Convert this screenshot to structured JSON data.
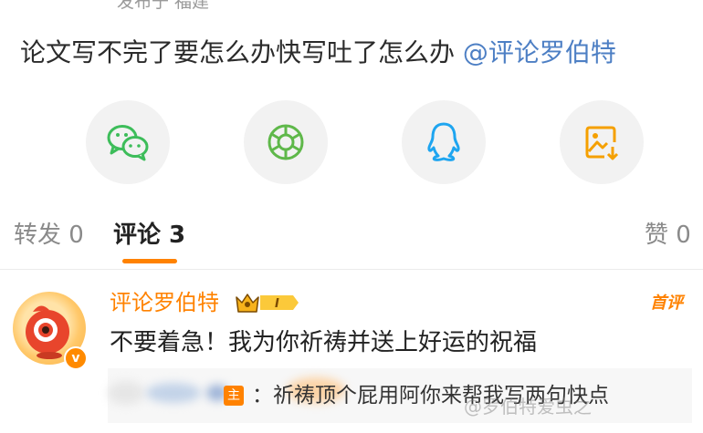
{
  "post": {
    "meta": "发布于 福建",
    "text": "论文写不完了要怎么办快写吐了怎么办 ",
    "mention": "@评论罗伯特"
  },
  "share": {
    "items": [
      {
        "icon": "wechat-icon",
        "color": "#3dbd5a"
      },
      {
        "icon": "moments-icon",
        "color": "#5fb84a"
      },
      {
        "icon": "qq-icon",
        "color": "#1ea5f0"
      },
      {
        "icon": "save-image-icon",
        "color": "#f5a000"
      }
    ]
  },
  "tabs": {
    "repost": "转发 0",
    "comments": "评论 3",
    "likes": "赞 0",
    "accent": "#ff8200"
  },
  "comment": {
    "username": "评论罗伯特",
    "vip_level": "I",
    "pinned_label": "首评",
    "text": "不要着急！我为你祈祷并送上好运的祝福",
    "reply": {
      "poster_tag": "主",
      "text": "：祈祷顶个屁用阿你来帮我写两句快点"
    }
  },
  "watermark": "@罗伯特爱虫之",
  "colors": {
    "mention": "#4d7fc4",
    "username": "#ff8200",
    "muted": "#8a8a8a"
  }
}
